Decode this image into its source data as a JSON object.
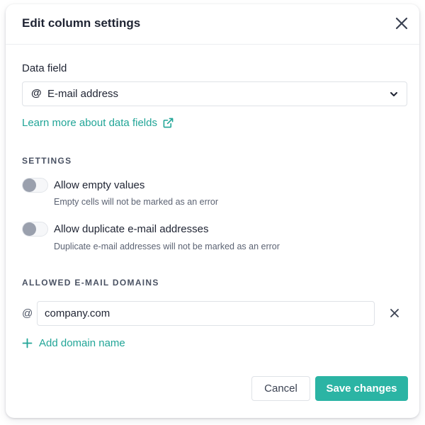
{
  "dialog": {
    "title": "Edit column settings"
  },
  "data_field": {
    "label": "Data field",
    "selected_value": "E-mail address",
    "selected_icon": "at-sign-icon",
    "icon_glyph": "@"
  },
  "learn_more": {
    "label": "Learn more about data fields",
    "icon": "external-link-icon"
  },
  "settings": {
    "section_title": "SETTINGS",
    "options": [
      {
        "label": "Allow empty values",
        "description": "Empty cells will not be marked as an error",
        "enabled": false
      },
      {
        "label": "Allow duplicate e-mail addresses",
        "description": "Duplicate e-mail addresses will not be marked as an error",
        "enabled": false
      }
    ]
  },
  "allowed_domains": {
    "section_title": "ALLOWED E-MAIL DOMAINS",
    "prefix": "@",
    "domains": [
      "company.com"
    ],
    "add_label": "Add domain name"
  },
  "footer": {
    "cancel_label": "Cancel",
    "save_label": "Save changes"
  },
  "colors": {
    "accent": "#21a597",
    "primary_button": "#2bb4a4",
    "text_primary": "#1f2433",
    "text_secondary": "#5c6373",
    "toggle_off_knob": "#9aa0ad",
    "border": "#dfe2e7"
  }
}
